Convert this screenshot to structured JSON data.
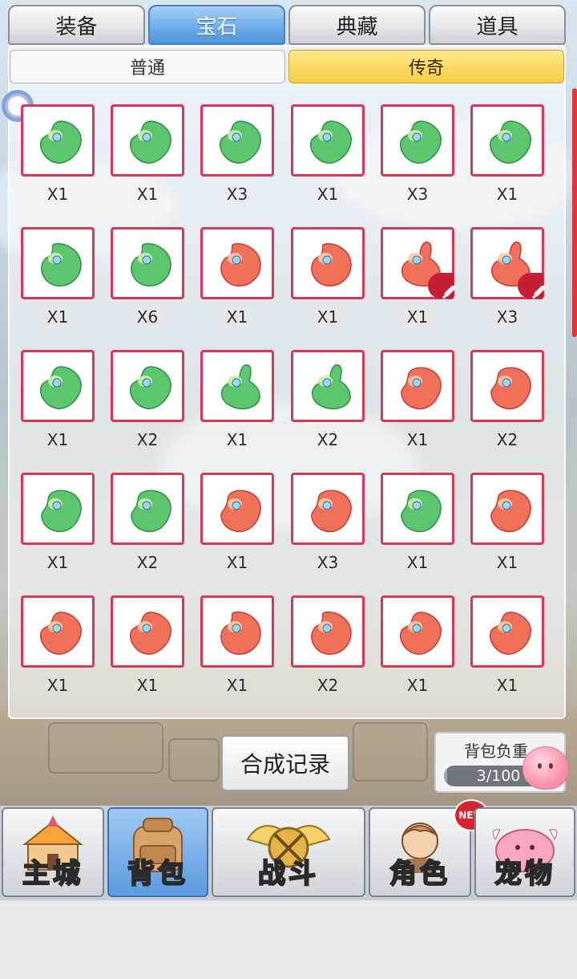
{
  "tabs": [
    {
      "label": "装备",
      "active": false
    },
    {
      "label": "宝石",
      "active": true
    },
    {
      "label": "典藏",
      "active": false
    },
    {
      "label": "道具",
      "active": false
    }
  ],
  "subtabs": [
    {
      "label": "普通",
      "active": false
    },
    {
      "label": "传奇",
      "active": true
    }
  ],
  "gems": [
    {
      "qty": "X1",
      "color": "green",
      "shape": "a"
    },
    {
      "qty": "X1",
      "color": "green",
      "shape": "a"
    },
    {
      "qty": "X3",
      "color": "green",
      "shape": "a"
    },
    {
      "qty": "X1",
      "color": "green",
      "shape": "a"
    },
    {
      "qty": "X3",
      "color": "green",
      "shape": "a"
    },
    {
      "qty": "X1",
      "color": "green",
      "shape": "a"
    },
    {
      "qty": "X1",
      "color": "green",
      "shape": "b"
    },
    {
      "qty": "X6",
      "color": "green",
      "shape": "b"
    },
    {
      "qty": "X1",
      "color": "red",
      "shape": "b"
    },
    {
      "qty": "X1",
      "color": "red",
      "shape": "b"
    },
    {
      "qty": "X1",
      "color": "red",
      "shape": "c",
      "equipped": true
    },
    {
      "qty": "X3",
      "color": "red",
      "shape": "c",
      "equipped": true
    },
    {
      "qty": "X1",
      "color": "green",
      "shape": "a"
    },
    {
      "qty": "X2",
      "color": "green",
      "shape": "a"
    },
    {
      "qty": "X1",
      "color": "green",
      "shape": "c"
    },
    {
      "qty": "X2",
      "color": "green",
      "shape": "c"
    },
    {
      "qty": "X1",
      "color": "red",
      "shape": "d"
    },
    {
      "qty": "X2",
      "color": "red",
      "shape": "d"
    },
    {
      "qty": "X1",
      "color": "green",
      "shape": "d"
    },
    {
      "qty": "X2",
      "color": "green",
      "shape": "d"
    },
    {
      "qty": "X1",
      "color": "red",
      "shape": "d"
    },
    {
      "qty": "X3",
      "color": "red",
      "shape": "d"
    },
    {
      "qty": "X1",
      "color": "green",
      "shape": "d"
    },
    {
      "qty": "X1",
      "color": "red",
      "shape": "d"
    },
    {
      "qty": "X1",
      "color": "red",
      "shape": "a"
    },
    {
      "qty": "X1",
      "color": "red",
      "shape": "a"
    },
    {
      "qty": "X1",
      "color": "red",
      "shape": "b"
    },
    {
      "qty": "X2",
      "color": "red",
      "shape": "b"
    },
    {
      "qty": "X1",
      "color": "red",
      "shape": "a"
    },
    {
      "qty": "X1",
      "color": "red",
      "shape": "a"
    }
  ],
  "record_button": "合成记录",
  "bag_weight": {
    "label": "背包负重",
    "value": "3/100",
    "fraction": 0.03
  },
  "nav": [
    {
      "label": "主城",
      "icon": "castle-icon",
      "active": false
    },
    {
      "label": "背包",
      "icon": "backpack-icon",
      "active": true
    },
    {
      "label": "战斗",
      "icon": "battle-icon",
      "active": false
    },
    {
      "label": "角色",
      "icon": "character-icon",
      "active": false,
      "badge": "NEW"
    },
    {
      "label": "宠物",
      "icon": "pet-icon",
      "active": false
    }
  ],
  "colors": {
    "slot_border": "#d8375a",
    "green_gem": "#5cc56e",
    "red_gem": "#f0705a",
    "active_tab": "#6eaeea",
    "active_subtab": "#f5cd44"
  }
}
